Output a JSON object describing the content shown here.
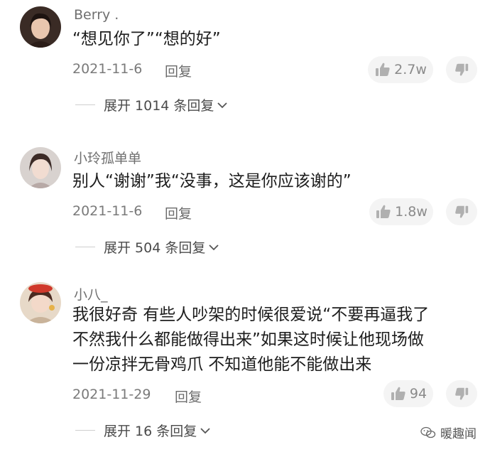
{
  "comments": [
    {
      "username": "Berry .",
      "lines": [
        "“想见你了”“想的好”"
      ],
      "date": "2021-11-6",
      "reply_label": "回复",
      "likes": "2.7w",
      "expand_label": "展开 1014 条回复"
    },
    {
      "username": "小玲孤单单",
      "lines": [
        "别人“谢谢”我“没事，这是你应该谢的”"
      ],
      "date": "2021-11-6",
      "reply_label": "回复",
      "likes": "1.8w",
      "expand_label": "展开 504 条回复"
    },
    {
      "username": "小八_",
      "lines": [
        "我很好奇 有些人吵架的时候很爱说“不要再逼我了",
        "不然我什么都能做得出来”如果这时候让他现场做",
        "一份凉拌无骨鸡爪 不知道他能不能做出来"
      ],
      "date": "2021-11-29",
      "reply_label": "回复",
      "likes": "94",
      "expand_label": "展开 16 条回复"
    }
  ],
  "watermark": "暖趣闻",
  "icons": {
    "like": "thumbs-up-icon",
    "dislike": "thumbs-down-icon",
    "expand": "chevron-down-icon",
    "watermark": "wechat-icon"
  }
}
